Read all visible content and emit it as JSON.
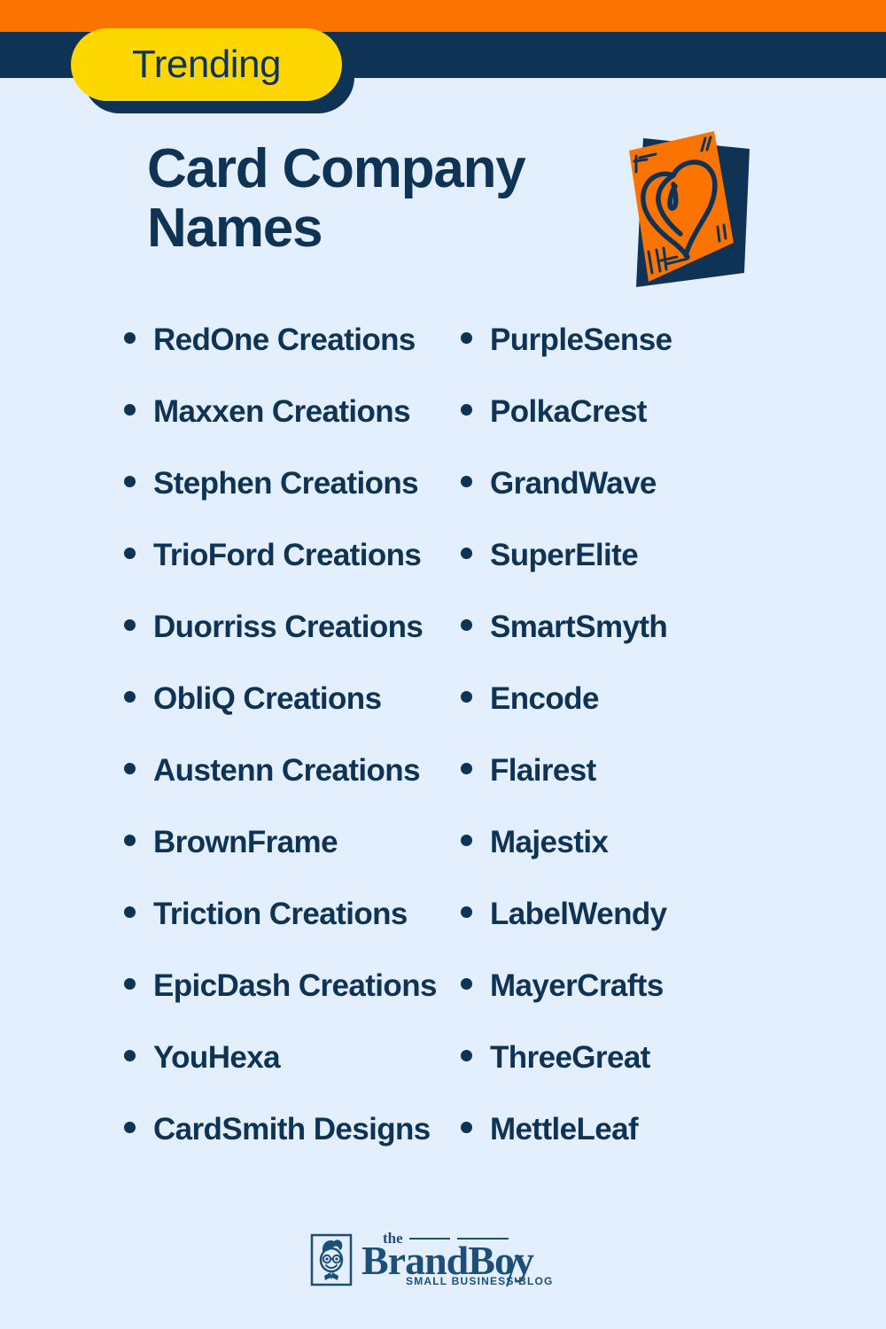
{
  "theme": {
    "orange": "#fb7401",
    "navy": "#0f3355",
    "yellow": "#ffd700",
    "background": "#e4effd"
  },
  "badge": {
    "label": "Trending"
  },
  "header": {
    "title_line1": "Card Company",
    "title_line2": "Names",
    "illustration": "greeting-card-with-heart"
  },
  "lists": {
    "left_column": [
      "RedOne Creations",
      "Maxxen Creations",
      "Stephen Creations",
      "TrioFord Creations",
      "Duorriss Creations",
      "ObliQ Creations",
      "Austenn Creations",
      "BrownFrame",
      "Triction Creations",
      "EpicDash Creations",
      "YouHexa",
      "CardSmith Designs"
    ],
    "right_column": [
      "PurpleSense",
      "PolkaCrest",
      "GrandWave",
      "SuperElite",
      "SmartSmyth",
      "Encode",
      "Flairest",
      "Majestix",
      "LabelWendy",
      "MayerCrafts",
      "ThreeGreat",
      "MettleLeaf"
    ]
  },
  "footer": {
    "logo_the": "the",
    "logo_brand": "Brand",
    "logo_boy": "Boy",
    "logo_tagline": "SMALL BUSINESS BLOG"
  }
}
